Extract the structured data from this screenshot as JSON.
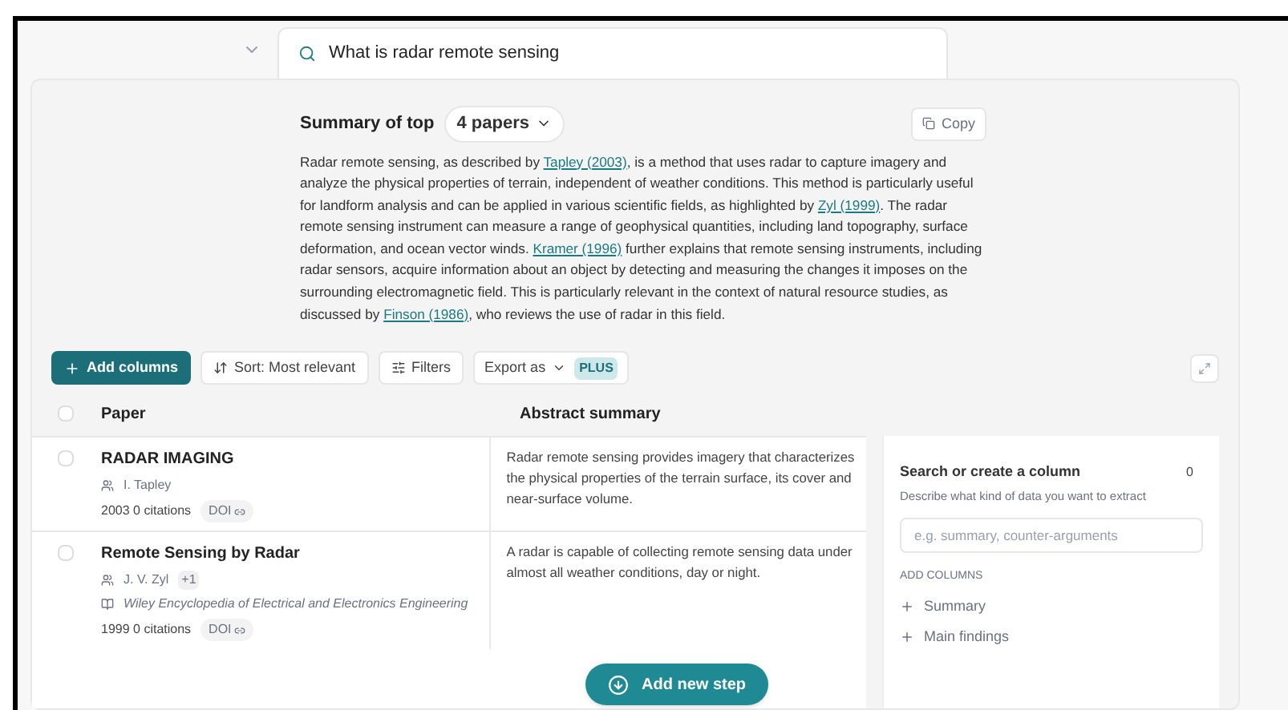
{
  "query": {
    "text": "What is radar remote sensing"
  },
  "summary": {
    "label": "Summary of top",
    "papers_button": "4 papers",
    "copy_button": "Copy",
    "paragraph": [
      {
        "kind": "text",
        "text": "Radar remote sensing, as described by "
      },
      {
        "kind": "link",
        "text": "Tapley (2003)"
      },
      {
        "kind": "text",
        "text": ", is a method that uses radar to capture imagery and analyze the physical properties of terrain, independent of weather conditions. This method is particularly useful for landform analysis and can be applied in various scientific fields, as highlighted by "
      },
      {
        "kind": "link",
        "text": "Zyl (1999)"
      },
      {
        "kind": "text",
        "text": ". The radar remote sensing instrument can measure a range of geophysical quantities, including land topography, surface deformation, and ocean vector winds. "
      },
      {
        "kind": "link",
        "text": "Kramer (1996)"
      },
      {
        "kind": "text",
        "text": " further explains that remote sensing instruments, including radar sensors, acquire information about an object by detecting and measuring the changes it imposes on the surrounding electromagnetic field. This is particularly relevant in the context of natural resource studies, as discussed by "
      },
      {
        "kind": "link",
        "text": "Finson (1986)"
      },
      {
        "kind": "text",
        "text": ", who reviews the use of radar in this field."
      }
    ]
  },
  "toolbar": {
    "add_columns": "Add columns",
    "sort": "Sort: Most relevant",
    "filters": "Filters",
    "export": "Export as",
    "export_badge": "PLUS"
  },
  "table": {
    "all_selected": false,
    "columns": [
      "Paper",
      "Abstract summary"
    ],
    "rows": [
      {
        "selected": false,
        "title": "RADAR IMAGING",
        "authors": "I. Tapley",
        "extra_authors": null,
        "venue": null,
        "meta": "2003 0 citations",
        "doi": "DOI",
        "abstract": "Radar remote sensing provides imagery that characterizes the physical properties of the terrain surface, its cover and near-surface volume."
      },
      {
        "selected": false,
        "title": "Remote Sensing by Radar",
        "authors": "J. V. Zyl",
        "extra_authors": "+1",
        "venue": "Wiley Encyclopedia of Electrical and Electronics Engineering",
        "meta": "1999 0 citations",
        "doi": "DOI",
        "abstract": "A radar is capable of collecting remote sensing data under almost all weather conditions, day or night."
      }
    ]
  },
  "add_step_button": "Add new step",
  "column_panel": {
    "title": "Search or create a column",
    "count": "0",
    "description": "Describe what kind of data you want to extract",
    "placeholder": "e.g. summary, counter-arguments",
    "section": "ADD COLUMNS",
    "options": [
      "Summary",
      "Main findings"
    ]
  }
}
